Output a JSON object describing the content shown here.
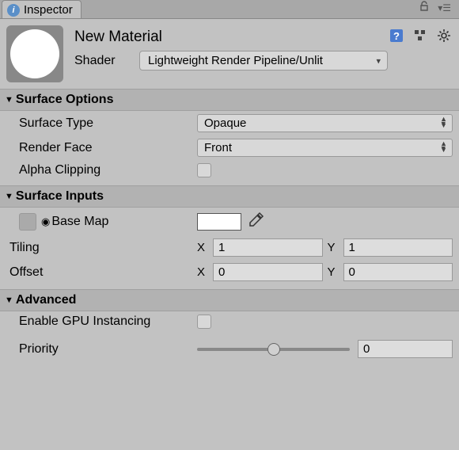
{
  "tab": {
    "title": "Inspector"
  },
  "header": {
    "name": "New Material",
    "shader_label": "Shader",
    "shader_value": "Lightweight Render Pipeline/Unlit"
  },
  "sections": {
    "surface_options": {
      "title": "Surface Options",
      "surface_type_label": "Surface Type",
      "surface_type_value": "Opaque",
      "render_face_label": "Render Face",
      "render_face_value": "Front",
      "alpha_clipping_label": "Alpha Clipping"
    },
    "surface_inputs": {
      "title": "Surface Inputs",
      "base_map_label": "Base Map",
      "tiling_label": "Tiling",
      "tiling_x": "1",
      "tiling_y": "1",
      "offset_label": "Offset",
      "offset_x": "0",
      "offset_y": "0",
      "axis_x": "X",
      "axis_y": "Y"
    },
    "advanced": {
      "title": "Advanced",
      "gpu_instancing_label": "Enable GPU Instancing",
      "priority_label": "Priority",
      "priority_value": "0"
    }
  }
}
